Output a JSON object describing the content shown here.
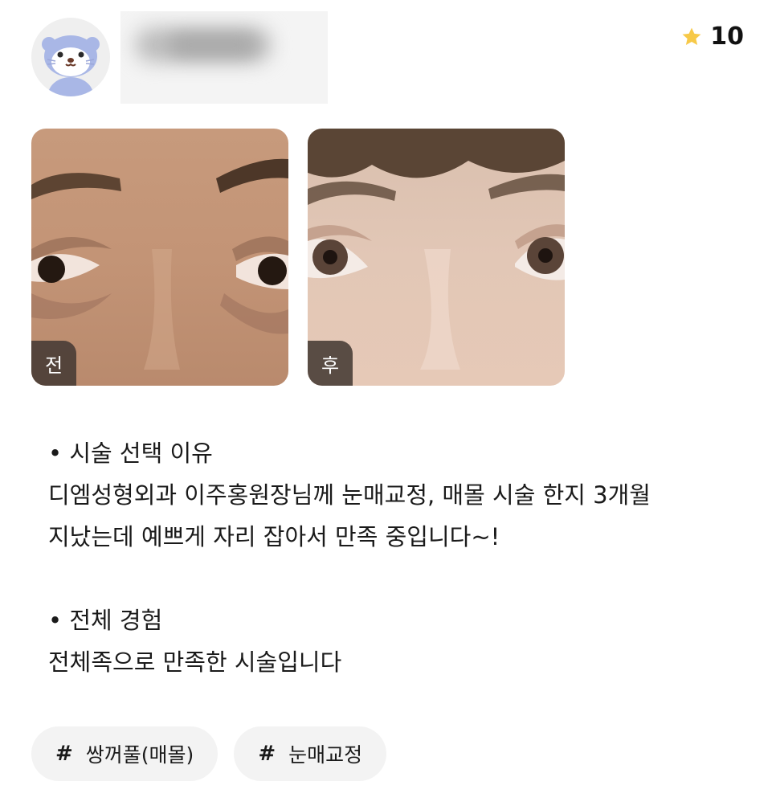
{
  "header": {
    "rating_value": "10",
    "colors": {
      "star": "#F7C948"
    }
  },
  "photos": [
    {
      "label": "전",
      "icon": "eyes-before-photo"
    },
    {
      "label": "후",
      "icon": "eyes-after-photo"
    }
  ],
  "review": {
    "section1_heading": "• 시술 선택 이유",
    "section1_line1": "디엠성형외과 이주홍원장님께 눈매교정, 매몰 시술 한지 3개월",
    "section1_line2": "지났는데 예쁘게 자리 잡아서 만족 중입니다~!",
    "section2_heading": "• 전체 경험",
    "section2_line1": "전체족으로 만족한 시술입니다"
  },
  "tags": [
    {
      "hash": "#",
      "label": "쌍꺼풀(매몰)"
    },
    {
      "hash": "#",
      "label": "눈매교정"
    }
  ]
}
